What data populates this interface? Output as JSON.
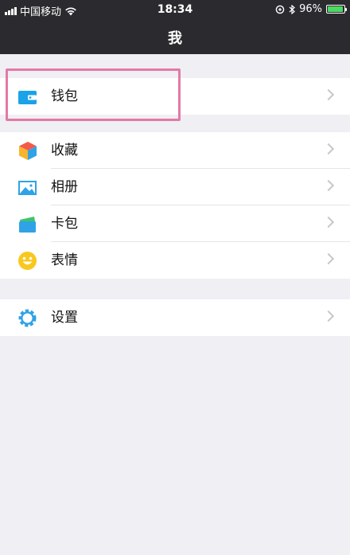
{
  "status_bar": {
    "carrier": "中国移动",
    "time": "18:34",
    "battery": "96%",
    "battery_fraction": 0.96
  },
  "header": {
    "title": "我"
  },
  "groups": [
    {
      "items": [
        {
          "label": "钱包",
          "icon": "wallet-icon"
        }
      ]
    },
    {
      "items": [
        {
          "label": "收藏",
          "icon": "cube-favorites-icon"
        },
        {
          "label": "相册",
          "icon": "photo-album-icon"
        },
        {
          "label": "卡包",
          "icon": "card-holder-icon"
        },
        {
          "label": "表情",
          "icon": "smiley-face-icon"
        }
      ]
    },
    {
      "items": [
        {
          "label": "设置",
          "icon": "gear-icon"
        }
      ]
    }
  ],
  "colors": {
    "header_bg": "#2b2b2f",
    "accent_blue": "#1aa3e8",
    "highlight": "#e27aa6",
    "battery_green": "#4cd964"
  }
}
